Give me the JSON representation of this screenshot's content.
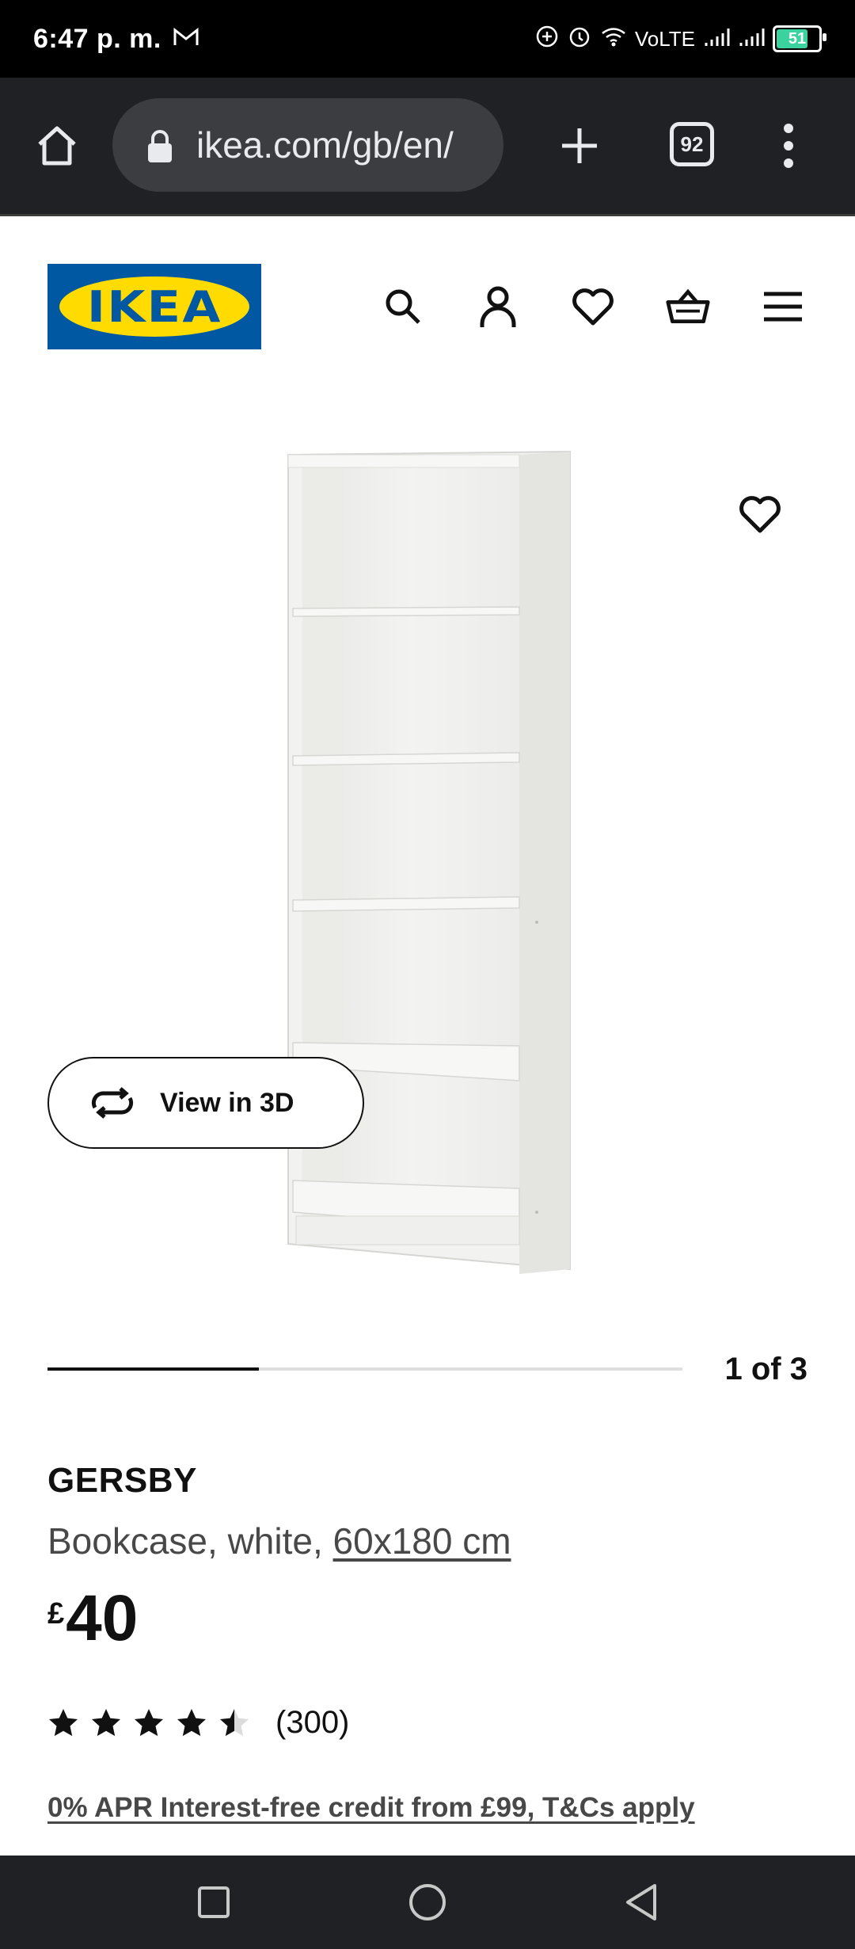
{
  "status_bar": {
    "time": "6:47 p. m.",
    "network_label": "VoLTE",
    "battery": "51",
    "icons": [
      "gmail-icon",
      "add-circle-icon",
      "alarm-icon",
      "wifi-icon",
      "signal-icon",
      "signal-icon",
      "battery-icon"
    ]
  },
  "browser": {
    "url": "ikea.com/gb/en/",
    "tab_count": "92"
  },
  "header": {
    "logo_text": "IKEA",
    "brand_colors": {
      "blue": "#0058a3",
      "yellow": "#ffdb00"
    },
    "icons": [
      "search-icon",
      "account-icon",
      "wishlist-icon",
      "basket-icon",
      "menu-icon"
    ]
  },
  "gallery": {
    "view_3d_label": "View in 3D",
    "pager": "1 of 3",
    "progress_fraction": 0.333
  },
  "product": {
    "name": "GERSBY",
    "description_prefix": "Bookcase, white, ",
    "dimensions": "60x180 cm",
    "currency": "£",
    "price": "40",
    "rating_value": 4.5,
    "rating_max": 5,
    "review_count": "(300)",
    "credit_link": "0% APR Interest-free credit from £99, T&Cs apply"
  },
  "nav_bar": {
    "icons": [
      "recents-square-icon",
      "home-circle-icon",
      "back-triangle-icon"
    ]
  }
}
